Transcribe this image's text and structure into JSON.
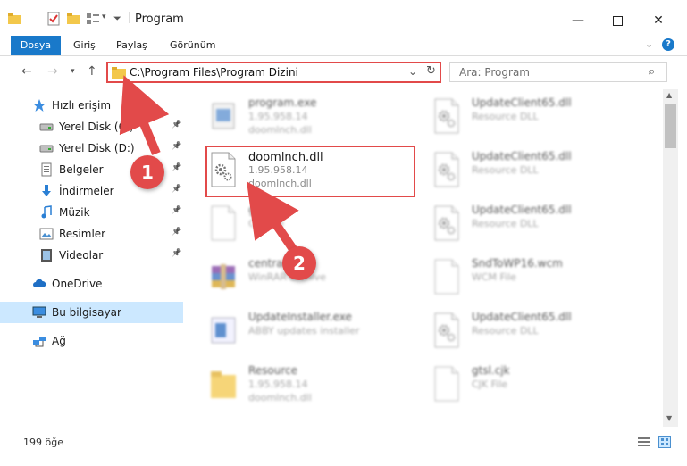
{
  "window": {
    "title": "Program"
  },
  "ribbon": {
    "tabs": [
      "Dosya",
      "Giriş",
      "Paylaş",
      "Görünüm"
    ]
  },
  "address": {
    "path": "C:\\Program Files\\Program Dizini"
  },
  "search": {
    "placeholder": "Ara: Program"
  },
  "nav": {
    "items": [
      {
        "label": "Hızlı erişim",
        "icon": "star-icon",
        "pinned": false
      },
      {
        "label": "Yerel Disk (C:)",
        "icon": "drive-icon",
        "pinned": true
      },
      {
        "label": "Yerel Disk (D:)",
        "icon": "drive-icon",
        "pinned": true
      },
      {
        "label": "Belgeler",
        "icon": "documents-icon",
        "pinned": true
      },
      {
        "label": "İndirmeler",
        "icon": "download-icon",
        "pinned": true
      },
      {
        "label": "Müzik",
        "icon": "music-icon",
        "pinned": true
      },
      {
        "label": "Resimler",
        "icon": "pictures-icon",
        "pinned": true
      },
      {
        "label": "Videolar",
        "icon": "video-icon",
        "pinned": true
      },
      {
        "label": "OneDrive",
        "icon": "cloud-icon",
        "pinned": false
      },
      {
        "label": "Bu bilgisayar",
        "icon": "computer-icon",
        "pinned": false
      },
      {
        "label": "Ağ",
        "icon": "network-icon",
        "pinned": false
      }
    ]
  },
  "files": {
    "left": [
      {
        "name": "program.exe",
        "line1": "1.95.958.14",
        "line2": "doomlnch.dll",
        "icon": "exe-icon"
      },
      {
        "name": "doomlnch.dll",
        "line1": "1.95.958.14",
        "line2": "doomlnch.dll",
        "icon": "dll-gear-icon"
      },
      {
        "name": "gtl.cjk",
        "line1": "CJK File",
        "line2": "",
        "icon": "file-icon"
      },
      {
        "name": "central.cab",
        "line1": "WinRAR archive",
        "line2": "",
        "icon": "archive-icon"
      },
      {
        "name": "UpdateInstaller.exe",
        "line1": "ABBY updates installer",
        "line2": "",
        "icon": "installer-icon"
      },
      {
        "name": "Resource",
        "line1": "1.95.958.14",
        "line2": "doomlnch.dll",
        "icon": "folder-icon"
      }
    ],
    "right": [
      {
        "name": "UpdateClient65.dll",
        "line1": "Resource DLL",
        "icon": "dll-gear-icon"
      },
      {
        "name": "UpdateClient65.dll",
        "line1": "Resource DLL",
        "icon": "dll-gear-icon"
      },
      {
        "name": "UpdateClient65.dll",
        "line1": "Resource DLL",
        "icon": "dll-gear-icon"
      },
      {
        "name": "SndToWP16.wcm",
        "line1": "WCM File",
        "icon": "file-icon"
      },
      {
        "name": "UpdateClient65.dll",
        "line1": "Resource DLL",
        "icon": "dll-gear-icon"
      },
      {
        "name": "gtsl.cjk",
        "line1": "CJK File",
        "icon": "file-icon"
      }
    ]
  },
  "status": {
    "count": "199 öğe"
  },
  "callouts": [
    "1",
    "2"
  ],
  "colors": {
    "accent": "#1979ca",
    "highlight": "#e24a4a",
    "selected": "#cce8ff"
  }
}
